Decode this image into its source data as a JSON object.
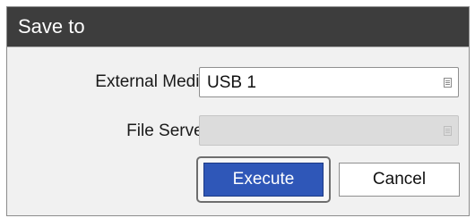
{
  "dialog": {
    "title": "Save to"
  },
  "fields": {
    "external_media": {
      "label": "External Media",
      "value": "USB 1"
    },
    "file_server": {
      "label": "File Server",
      "value": ""
    }
  },
  "buttons": {
    "execute": "Execute",
    "cancel": "Cancel"
  },
  "colors": {
    "titlebar": "#3d3d3d",
    "primary_button": "#2f57b8",
    "dialog_background": "#f1f1f1"
  },
  "icons": {
    "dropdown": "list-icon"
  }
}
